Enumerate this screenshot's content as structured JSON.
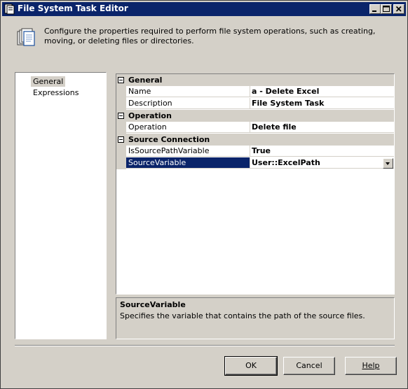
{
  "window": {
    "title": "File System Task Editor"
  },
  "header": {
    "description": "Configure the properties required to perform file system operations, such as creating, moving, or deleting files or directories."
  },
  "nav": {
    "items": [
      {
        "label": "General",
        "selected": true
      },
      {
        "label": "Expressions",
        "selected": false
      }
    ]
  },
  "grid": {
    "categories": [
      {
        "label": "General",
        "properties": [
          {
            "name": "Name",
            "value": "a - Delete Excel"
          },
          {
            "name": "Description",
            "value": "File System Task"
          }
        ]
      },
      {
        "label": "Operation",
        "properties": [
          {
            "name": "Operation",
            "value": "Delete file"
          }
        ]
      },
      {
        "label": "Source Connection",
        "properties": [
          {
            "name": "IsSourcePathVariable",
            "value": "True"
          },
          {
            "name": "SourceVariable",
            "value": "User::ExcelPath"
          }
        ]
      }
    ]
  },
  "help": {
    "title": "SourceVariable",
    "text": "Specifies the variable that contains the path of the source files."
  },
  "buttons": {
    "ok": "OK",
    "cancel": "Cancel",
    "help": "Help"
  },
  "colors": {
    "titlebar": "#0a246a",
    "face": "#d4d0c8",
    "selection": "#0a246a"
  }
}
